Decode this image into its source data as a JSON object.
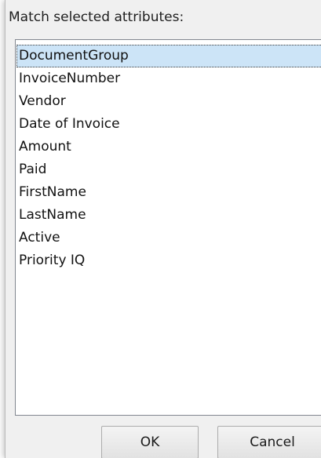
{
  "dialog": {
    "prompt": "Match selected attributes:",
    "attributes": [
      {
        "label": "DocumentGroup",
        "selected": true
      },
      {
        "label": "InvoiceNumber",
        "selected": false
      },
      {
        "label": "Vendor",
        "selected": false
      },
      {
        "label": "Date of Invoice",
        "selected": false
      },
      {
        "label": "Amount",
        "selected": false
      },
      {
        "label": "Paid",
        "selected": false
      },
      {
        "label": "FirstName",
        "selected": false
      },
      {
        "label": "LastName",
        "selected": false
      },
      {
        "label": "Active",
        "selected": false
      },
      {
        "label": "Priority IQ",
        "selected": false
      }
    ],
    "ok_label": "OK",
    "cancel_label": "Cancel"
  },
  "colors": {
    "selection": "#cce4f7",
    "dialog_background": "#f0f0f0"
  }
}
